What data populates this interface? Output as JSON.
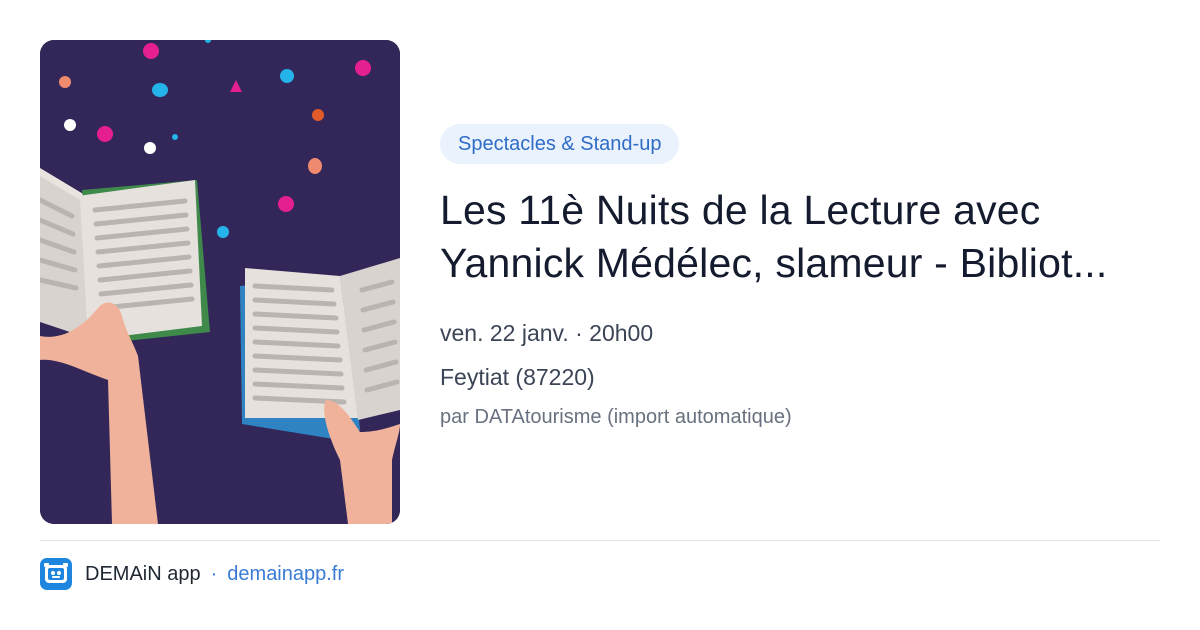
{
  "event": {
    "category": "Spectacles & Stand-up",
    "title_line1": "Les 11è Nuits de la Lecture avec",
    "title_line2": "Yannick Médélec, slameur - Bibliot...",
    "date": "ven. 22 janv. · 20h00",
    "location": "Feytiat (87220)",
    "source": "par DATAtourisme (import automatique)"
  },
  "illustration": {
    "icon": "open-books-in-hands-illustration",
    "background": "#322758"
  },
  "footer": {
    "app_name": "DEMAiN app",
    "separator": "·",
    "site": "demainapp.fr",
    "logo_icon": "demain-app-logo-icon"
  },
  "colors": {
    "accent": "#3a7bd5",
    "badge_bg": "#eaf2fd",
    "title": "#141b2e"
  }
}
